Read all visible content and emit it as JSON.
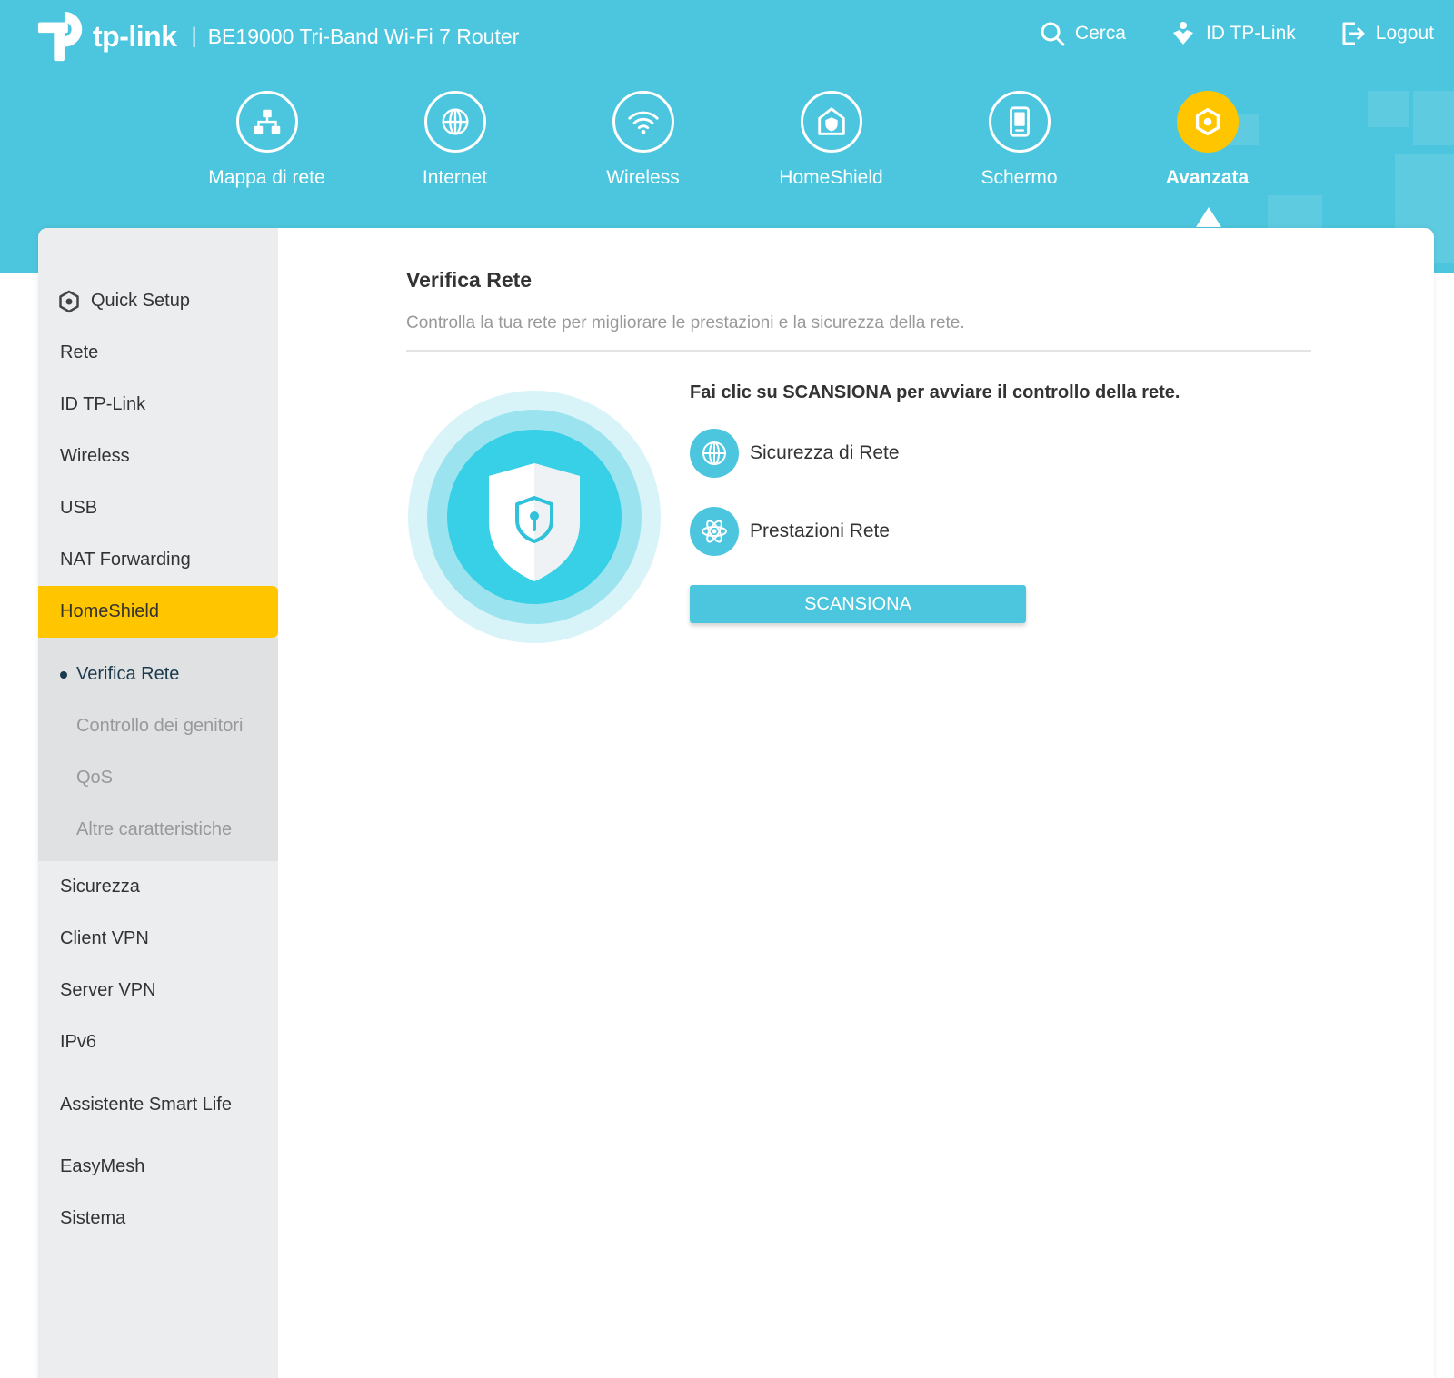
{
  "header": {
    "logo_text": "tp-link",
    "separator": "|",
    "model": "BE19000 Tri-Band Wi-Fi 7 Router",
    "actions": [
      {
        "label": "Cerca",
        "icon": "search-icon"
      },
      {
        "label": "ID TP-Link",
        "icon": "tplink-id-icon"
      },
      {
        "label": "Logout",
        "icon": "logout-icon"
      }
    ]
  },
  "main_nav": [
    {
      "label": "Mappa di rete",
      "icon": "network-map-icon"
    },
    {
      "label": "Internet",
      "icon": "globe-icon"
    },
    {
      "label": "Wireless",
      "icon": "wifi-icon"
    },
    {
      "label": "HomeShield",
      "icon": "homeshield-icon"
    },
    {
      "label": "Schermo",
      "icon": "screen-icon"
    },
    {
      "label": "Avanzata",
      "icon": "advanced-gear-icon",
      "active": true
    }
  ],
  "sidebar": {
    "quick_setup": "Quick Setup",
    "items_before": [
      "Rete",
      "ID TP-Link",
      "Wireless",
      "USB",
      "NAT Forwarding"
    ],
    "active": "HomeShield",
    "submenu": [
      "Verifica Rete",
      "Controllo dei genitori",
      "QoS",
      "Altre caratteristiche"
    ],
    "items_after": [
      "Sicurezza",
      "Client VPN",
      "Server VPN",
      "IPv6",
      "Assistente Smart Life",
      "EasyMesh",
      "Sistema"
    ]
  },
  "content": {
    "title": "Verifica Rete",
    "description": "Controlla la tua rete per migliorare le prestazioni e la sicurezza della rete.",
    "hint": "Fai clic su SCANSIONA per avviare il controllo della rete.",
    "checks": [
      {
        "label": "Sicurezza di Rete",
        "icon": "globe-icon"
      },
      {
        "label": "Prestazioni Rete",
        "icon": "atom-icon"
      }
    ],
    "button_label": "SCANSIONA"
  },
  "colors": {
    "brand": "#4cc6de",
    "accent": "#ffc600",
    "sidebar_bg": "#ebedef",
    "submenu_bg": "#dfe1e3"
  }
}
